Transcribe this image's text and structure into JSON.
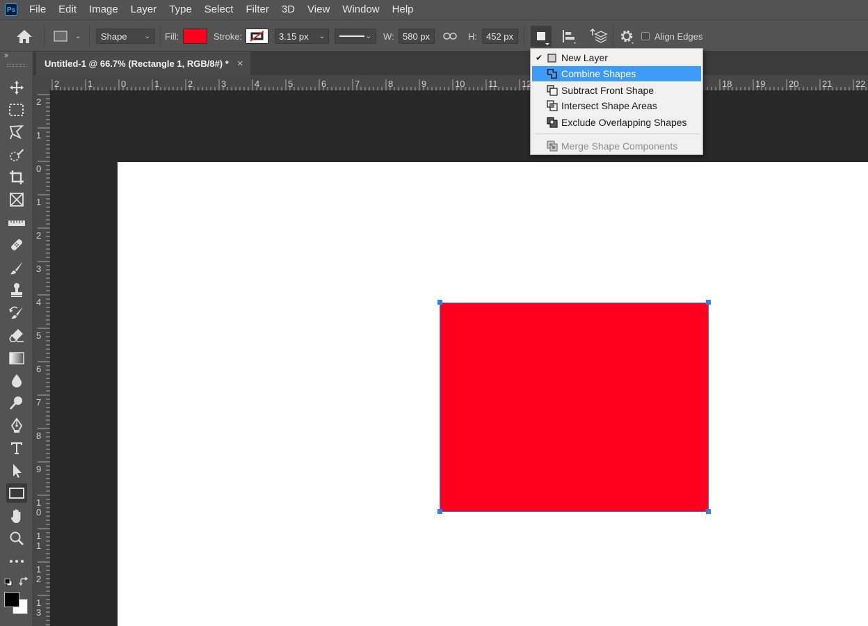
{
  "app": {
    "logo": "Ps"
  },
  "menubar": {
    "items": [
      "File",
      "Edit",
      "Image",
      "Layer",
      "Type",
      "Select",
      "Filter",
      "3D",
      "View",
      "Window",
      "Help"
    ]
  },
  "options": {
    "mode_value": "Shape",
    "fill_label": "Fill:",
    "fill_color": "#ff0021",
    "stroke_label": "Stroke:",
    "stroke_width": "3.15 px",
    "width_label": "W:",
    "width_value": "580 px",
    "height_label": "H:",
    "height_value": "452 px",
    "align_edges_label": "Align Edges",
    "align_edges_checked": false
  },
  "document": {
    "tab_title": "Untitled-1 @ 66.7% (Rectangle 1, RGB/8#) *",
    "close_glyph": "×"
  },
  "rulers": {
    "top_labels": [
      "2",
      "1",
      "0",
      "1",
      "2",
      "3",
      "4",
      "5",
      "6",
      "7",
      "8",
      "9",
      "10",
      "11",
      "12",
      "18",
      "19",
      "20",
      "21",
      "22"
    ],
    "left_labels": [
      "2",
      "1",
      "0",
      "1",
      "2",
      "3",
      "4",
      "5",
      "6",
      "7",
      "8",
      "9",
      "1\n0",
      "1\n1",
      "1\n2",
      "1\n3"
    ]
  },
  "shape": {
    "fill": "#ff0021",
    "name": "Rectangle 1"
  },
  "shape_ops_menu": {
    "items": [
      {
        "label": "New Layer",
        "checked": true,
        "highlighted": false,
        "disabled": false,
        "icon": "new-layer-icon"
      },
      {
        "label": "Combine Shapes",
        "checked": false,
        "highlighted": true,
        "disabled": false,
        "icon": "combine-shapes-icon"
      },
      {
        "label": "Subtract Front Shape",
        "checked": false,
        "highlighted": false,
        "disabled": false,
        "icon": "subtract-front-shape-icon"
      },
      {
        "label": "Intersect Shape Areas",
        "checked": false,
        "highlighted": false,
        "disabled": false,
        "icon": "intersect-shape-areas-icon"
      },
      {
        "label": "Exclude Overlapping Shapes",
        "checked": false,
        "highlighted": false,
        "disabled": false,
        "icon": "exclude-overlapping-shapes-icon"
      },
      {
        "label": "Merge Shape Components",
        "checked": false,
        "highlighted": false,
        "disabled": true,
        "icon": "merge-shape-components-icon"
      }
    ]
  },
  "colors": {
    "accent": "#3d9bf5",
    "ui_dark": "#535353",
    "canvas_bg": "#282828",
    "foreground_swatch": "#000000",
    "background_swatch": "#ffffff"
  }
}
